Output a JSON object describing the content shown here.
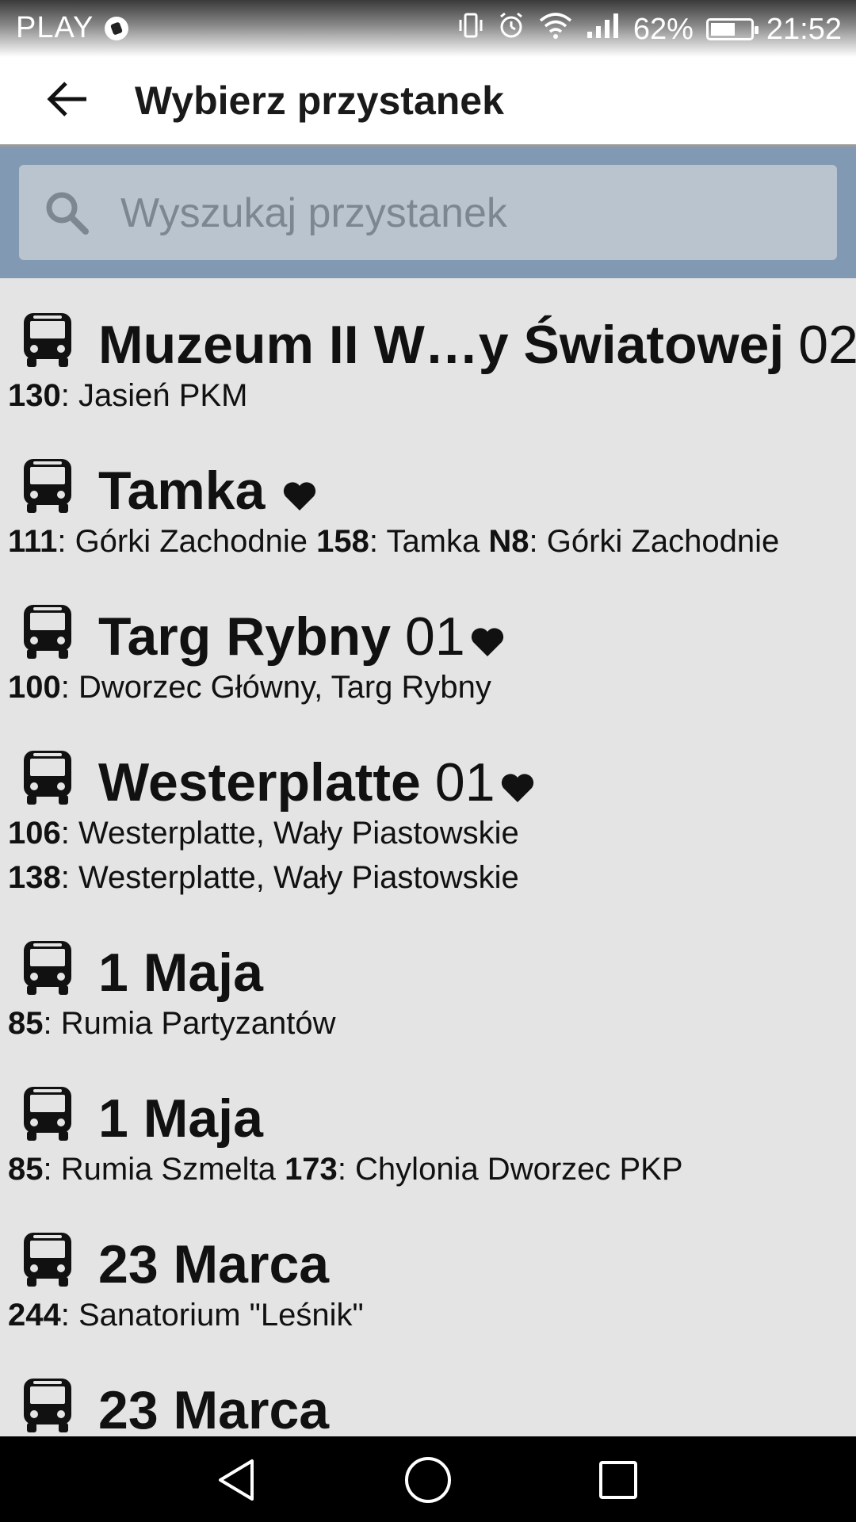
{
  "status_bar": {
    "carrier": "PLAY",
    "battery_percent": "62%",
    "battery_level": 0.62,
    "time": "21:52",
    "icons": [
      "vibrate-icon",
      "alarm-icon",
      "wifi-icon",
      "signal-icon",
      "battery-icon"
    ]
  },
  "app_bar": {
    "title": "Wybierz przystanek",
    "back_icon": "arrow-back-icon"
  },
  "search": {
    "placeholder": "Wyszukaj przystanek",
    "value": ""
  },
  "stops": [
    {
      "name": "Muzeum II W…y Światowej",
      "code": "02",
      "favorite": true,
      "lines": [
        [
          {
            "num": "130",
            "dest": "Jasień PKM"
          }
        ]
      ]
    },
    {
      "name": "Tamka",
      "code": "",
      "favorite": true,
      "lines": [
        [
          {
            "num": "111",
            "dest": "Górki Zachodnie"
          },
          {
            "num": "158",
            "dest": "Tamka"
          },
          {
            "num": "N8",
            "dest": "Górki Zachodnie"
          }
        ]
      ]
    },
    {
      "name": "Targ Rybny",
      "code": "01",
      "favorite": true,
      "lines": [
        [
          {
            "num": "100",
            "dest": "Dworzec Główny, Targ Rybny"
          }
        ]
      ]
    },
    {
      "name": "Westerplatte",
      "code": "01",
      "favorite": true,
      "lines": [
        [
          {
            "num": "106",
            "dest": "Westerplatte, Wały Piastowskie"
          }
        ],
        [
          {
            "num": "138",
            "dest": "Westerplatte, Wały Piastowskie"
          }
        ]
      ]
    },
    {
      "name": "1 Maja",
      "code": "",
      "favorite": false,
      "lines": [
        [
          {
            "num": "85",
            "dest": "Rumia Partyzantów"
          }
        ]
      ]
    },
    {
      "name": "1 Maja",
      "code": "",
      "favorite": false,
      "lines": [
        [
          {
            "num": "85",
            "dest": "Rumia Szmelta"
          },
          {
            "num": "173",
            "dest": "Chylonia Dworzec PKP"
          }
        ]
      ]
    },
    {
      "name": "23 Marca",
      "code": "",
      "favorite": false,
      "lines": [
        [
          {
            "num": "244",
            "dest": "Sanatorium \"Leśnik\""
          }
        ]
      ]
    },
    {
      "name": "23 Marca",
      "code": "",
      "favorite": false,
      "lines": []
    }
  ],
  "nav_bar": {
    "buttons": [
      "back-triangle-icon",
      "home-circle-icon",
      "recents-square-icon"
    ]
  }
}
